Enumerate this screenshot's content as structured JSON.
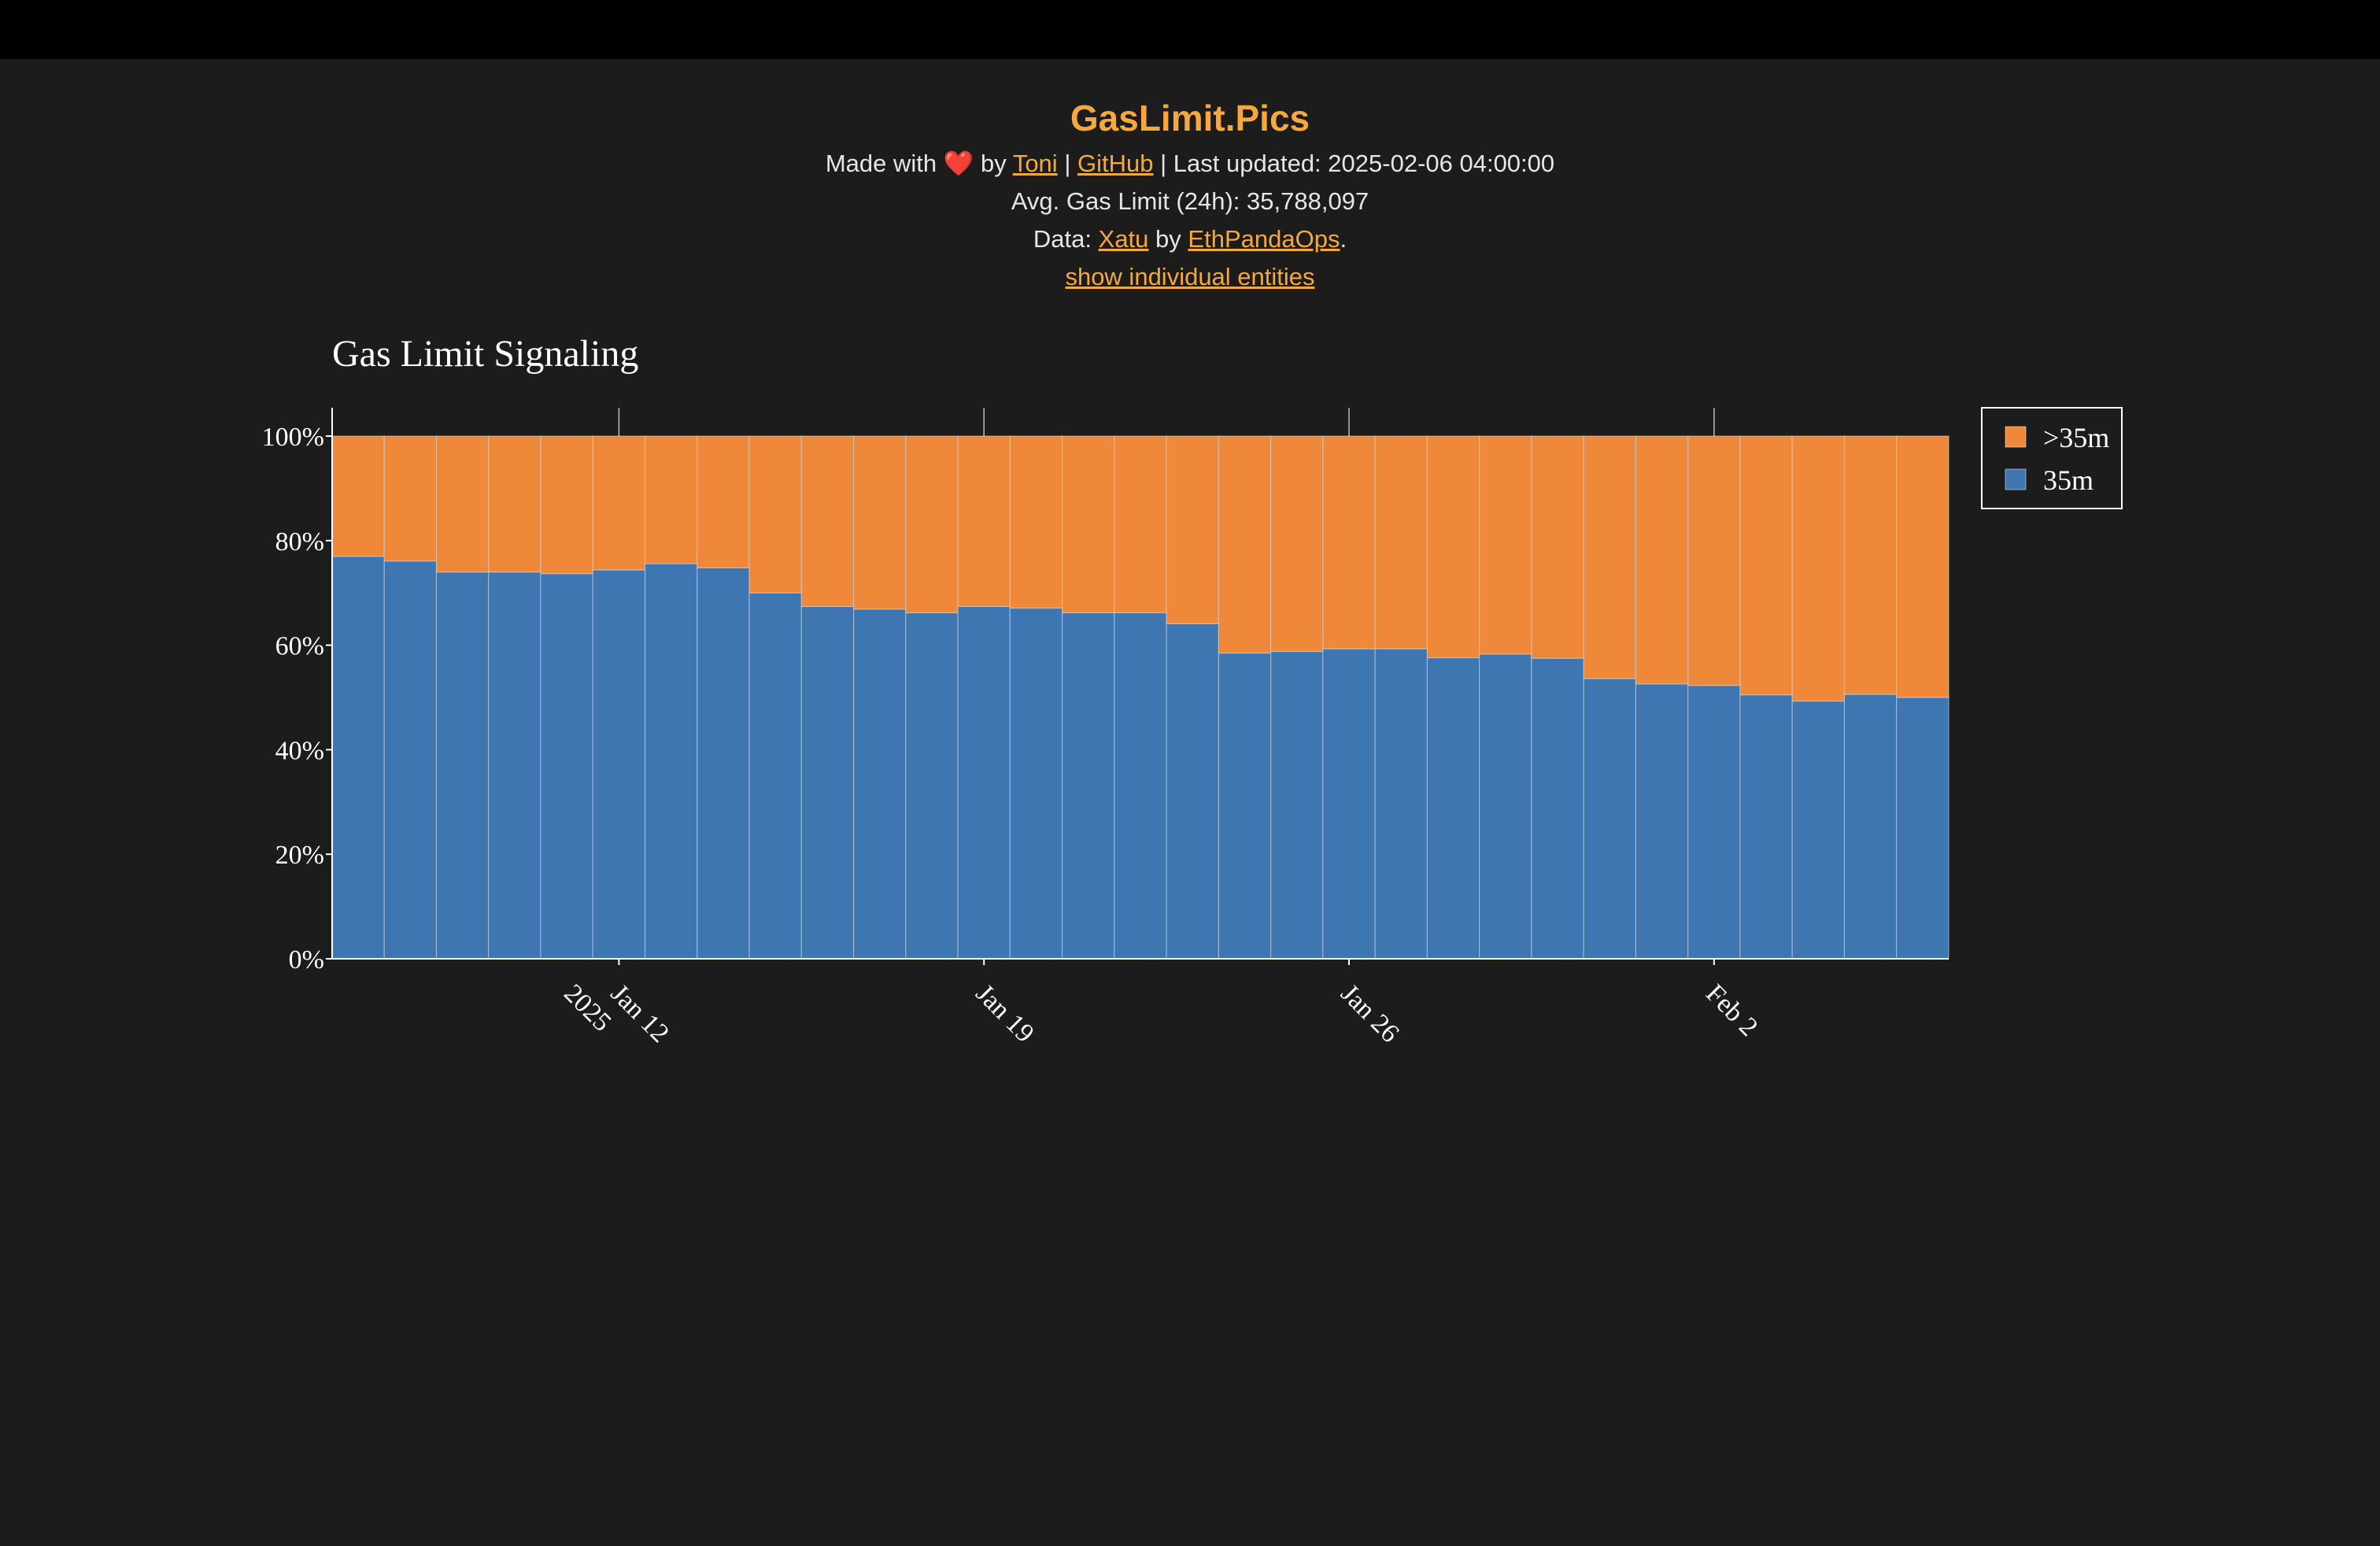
{
  "header": {
    "title": "GasLimit.Pics",
    "made_with": "Made with",
    "heart": "❤️",
    "by": "by",
    "author_link": "Toni",
    "separator1": "|",
    "github_link": "GitHub",
    "separator2": "|",
    "last_updated": "Last updated: 2025-02-06 04:00:00",
    "avg_gas_limit": "Avg. Gas Limit (24h): 35,788,097",
    "data_prefix": "Data:",
    "data_source_link": "Xatu",
    "data_by": "by",
    "data_org_link": "EthPandaOps",
    "data_suffix": ".",
    "toggle_link": "show individual entities"
  },
  "colors": {
    "background": "#1c1c1c",
    "accent": "#f5a840",
    "series_35m": "#3d76b0",
    "series_gt35m": "#f0883a"
  },
  "chart_data": {
    "type": "bar",
    "stacked": true,
    "title": "Gas Limit Signaling",
    "xlabel": "",
    "ylabel": "",
    "ylim": [
      0,
      100
    ],
    "yticks": [
      "0%",
      "20%",
      "40%",
      "60%",
      "80%",
      "100%"
    ],
    "x_ticks": [
      {
        "date": "2025-01-12",
        "label": "Jan 12",
        "sublabel": "2025"
      },
      {
        "date": "2025-01-19",
        "label": "Jan 19",
        "sublabel": ""
      },
      {
        "date": "2025-01-26",
        "label": "Jan 26",
        "sublabel": ""
      },
      {
        "date": "2025-02-02",
        "label": "Feb 2",
        "sublabel": ""
      }
    ],
    "categories": [
      "2025-01-07",
      "2025-01-08",
      "2025-01-09",
      "2025-01-10",
      "2025-01-11",
      "2025-01-12",
      "2025-01-13",
      "2025-01-14",
      "2025-01-15",
      "2025-01-16",
      "2025-01-17",
      "2025-01-18",
      "2025-01-19",
      "2025-01-20",
      "2025-01-21",
      "2025-01-22",
      "2025-01-23",
      "2025-01-24",
      "2025-01-25",
      "2025-01-26",
      "2025-01-27",
      "2025-01-28",
      "2025-01-29",
      "2025-01-30",
      "2025-01-31",
      "2025-02-01",
      "2025-02-02",
      "2025-02-03",
      "2025-02-04",
      "2025-02-05",
      "2025-02-06"
    ],
    "series": [
      {
        "name": "35m",
        "color": "#3d76b0",
        "values": [
          77.0,
          76.1,
          74.0,
          74.0,
          73.7,
          74.4,
          75.6,
          74.8,
          70.0,
          67.4,
          66.9,
          66.2,
          67.4,
          67.1,
          66.2,
          66.2,
          64.1,
          58.5,
          58.8,
          59.3,
          59.3,
          57.6,
          58.3,
          57.5,
          53.6,
          52.6,
          52.3,
          50.5,
          49.3,
          50.6,
          50.0
        ]
      },
      {
        "name": ">35m",
        "color": "#f0883a",
        "values": [
          23.0,
          23.9,
          26.0,
          26.0,
          26.3,
          25.6,
          24.4,
          25.2,
          30.0,
          32.6,
          33.1,
          33.8,
          32.6,
          32.9,
          33.8,
          33.8,
          35.9,
          41.5,
          41.2,
          40.7,
          40.7,
          42.4,
          41.7,
          42.5,
          46.4,
          47.4,
          47.7,
          49.5,
          50.7,
          49.4,
          50.0
        ]
      }
    ],
    "legend": {
      "position": "top-right",
      "order": [
        ">35m",
        "35m"
      ]
    }
  }
}
